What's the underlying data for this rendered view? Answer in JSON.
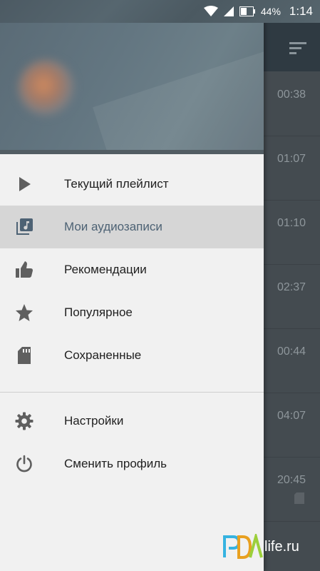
{
  "status_bar": {
    "battery_percent": "44%",
    "time": "1:14",
    "icons": [
      "wifi-icon",
      "cell-signal-icon",
      "battery-icon"
    ]
  },
  "drawer": {
    "menu": [
      {
        "label": "Текущий плейлист",
        "icon": "play-icon",
        "active": false
      },
      {
        "label": "Мои аудиозаписи",
        "icon": "library-music-icon",
        "active": true
      },
      {
        "label": "Рекомендации",
        "icon": "thumb-up-icon",
        "active": false
      },
      {
        "label": "Популярное",
        "icon": "star-icon",
        "active": false
      },
      {
        "label": "Сохраненные",
        "icon": "sd-card-icon",
        "active": false
      }
    ],
    "secondary_menu": [
      {
        "label": "Настройки",
        "icon": "gear-icon"
      },
      {
        "label": "Сменить профиль",
        "icon": "power-icon"
      }
    ]
  },
  "background_list": {
    "durations": [
      "00:38",
      "01:07",
      "01:10",
      "02:37",
      "00:44",
      "04:07",
      "20:45"
    ]
  },
  "watermark": {
    "text": "life.ru"
  },
  "colors": {
    "drawer_bg": "#f1f1f1",
    "active_item_bg": "#d6d6d6",
    "active_item_text": "#4d6274",
    "icon_gray": "#5f5f5f",
    "toolbar": "#2f3a42"
  }
}
